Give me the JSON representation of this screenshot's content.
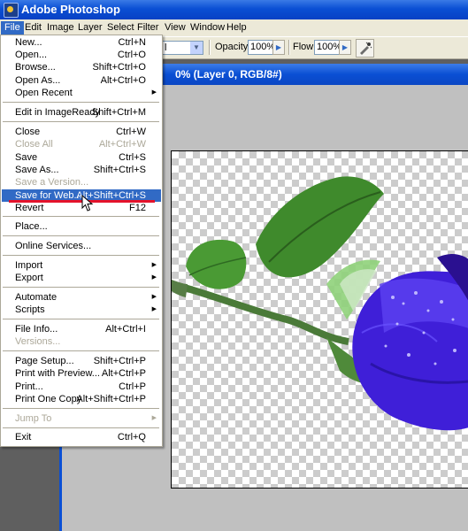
{
  "app": {
    "title": "Adobe Photoshop"
  },
  "menubar": [
    "File",
    "Edit",
    "Image",
    "Layer",
    "Select",
    "Filter",
    "View",
    "Window",
    "Help"
  ],
  "options": {
    "mode_value": "l",
    "opacity_label": "Opacity:",
    "opacity_value": "100%",
    "flow_label": "Flow:",
    "flow_value": "100%"
  },
  "document": {
    "title_fragment": "0% (Layer 0, RGB/8#)"
  },
  "file_menu": {
    "items": [
      {
        "label": "New...",
        "shortcut": "Ctrl+N"
      },
      {
        "label": "Open...",
        "shortcut": "Ctrl+O"
      },
      {
        "label": "Browse...",
        "shortcut": "Shift+Ctrl+O"
      },
      {
        "label": "Open As...",
        "shortcut": "Alt+Ctrl+O"
      },
      {
        "label": "Open Recent",
        "shortcut": ""
      },
      {
        "label": "Edit in ImageReady",
        "shortcut": "Shift+Ctrl+M"
      },
      {
        "label": "Close",
        "shortcut": "Ctrl+W"
      },
      {
        "label": "Close All",
        "shortcut": "Alt+Ctrl+W"
      },
      {
        "label": "Save",
        "shortcut": "Ctrl+S"
      },
      {
        "label": "Save As...",
        "shortcut": "Shift+Ctrl+S"
      },
      {
        "label": "Save a Version...",
        "shortcut": ""
      },
      {
        "label": "Save for Web...",
        "shortcut": "Alt+Shift+Ctrl+S"
      },
      {
        "label": "Revert",
        "shortcut": "F12"
      },
      {
        "label": "Place...",
        "shortcut": ""
      },
      {
        "label": "Online Services...",
        "shortcut": ""
      },
      {
        "label": "Import",
        "shortcut": ""
      },
      {
        "label": "Export",
        "shortcut": ""
      },
      {
        "label": "Automate",
        "shortcut": ""
      },
      {
        "label": "Scripts",
        "shortcut": ""
      },
      {
        "label": "File Info...",
        "shortcut": "Alt+Ctrl+I"
      },
      {
        "label": "Versions...",
        "shortcut": ""
      },
      {
        "label": "Page Setup...",
        "shortcut": "Shift+Ctrl+P"
      },
      {
        "label": "Print with Preview...",
        "shortcut": "Alt+Ctrl+P"
      },
      {
        "label": "Print...",
        "shortcut": "Ctrl+P"
      },
      {
        "label": "Print One Copy",
        "shortcut": "Alt+Shift+Ctrl+P"
      },
      {
        "label": "Jump To",
        "shortcut": ""
      },
      {
        "label": "Exit",
        "shortcut": "Ctrl+Q"
      }
    ]
  },
  "colors": {
    "xp_blue": "#0a4fd4",
    "menu_highlight": "#316ac5",
    "annotation_underline": "#e4132b",
    "rose": "#3f1fd8",
    "leaf": "#3f8a2c"
  }
}
